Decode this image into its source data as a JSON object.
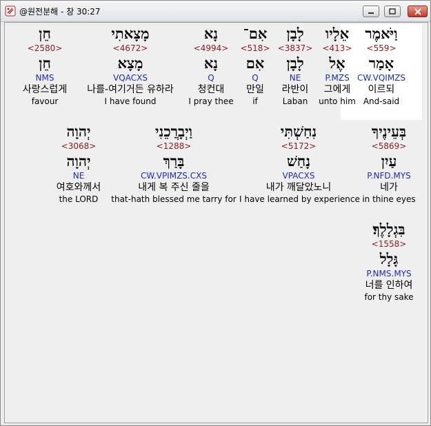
{
  "window": {
    "title": "@원전분해 - 창 30:27",
    "icon": "bible-icon"
  },
  "words": [
    {
      "heb": "וַיֹּאמֶר",
      "strong": "<559>",
      "lemma": "אָמַר",
      "parse": "CW.VQIMZS",
      "kor": "이르되",
      "eng": "And-said",
      "highlight": true
    },
    {
      "heb": "אֵלָיו",
      "strong": "<413>",
      "lemma": "אֶל",
      "parse": "P.MZS",
      "kor": "그에게",
      "eng": "unto him"
    },
    {
      "heb": "לָבָן",
      "strong": "<3837>",
      "lemma": "לָבָן",
      "parse": "NE",
      "kor": "라반이",
      "eng": "Laban"
    },
    {
      "heb": "אִם־",
      "strong": "<518>",
      "lemma": "אִם",
      "parse": "Q",
      "kor": "만일",
      "eng": "if"
    },
    {
      "heb": "נָא",
      "strong": "<4994>",
      "lemma": "נָא",
      "parse": "Q",
      "kor": "청컨대",
      "eng": "I pray thee"
    },
    {
      "heb": "מָצָאתִי",
      "strong": "<4672>",
      "lemma": "מָצָא",
      "parse": "VQACXS",
      "kor": "나를-여기거든 유하라",
      "eng": "I have found"
    },
    {
      "heb": "חֵן",
      "strong": "<2580>",
      "lemma": "חֵן",
      "parse": "NMS",
      "kor": "사랑스럽게",
      "eng": "favour"
    },
    {
      "heb": "בְּעֵינֶיךָ",
      "strong": "<5869>",
      "lemma": "עַיִן",
      "parse": "P.NFD.MYS",
      "kor": "네가",
      "eng": "in thine eyes"
    },
    {
      "heb": "נִחַשְׁתִּי",
      "strong": "<5172>",
      "lemma": "נָחַשׁ",
      "parse": "VPACXS",
      "kor": "내가 깨달았노니",
      "eng": "I have learned by experience"
    },
    {
      "heb": "וַיְבָרֲכֵנִי",
      "strong": "<1288>",
      "lemma": "בָּרַךְ",
      "parse": "CW.VPIMZS.CXS",
      "kor": "내게 복 주신 줄을",
      "eng": "that-hath blessed me tarry for"
    },
    {
      "heb": "יְהוָה",
      "strong": "<3068>",
      "lemma": "יְהוָה",
      "parse": "NE",
      "kor": "여호와께서",
      "eng": "the LORD"
    },
    {
      "heb": "בִּגְלָלֶךָ׃",
      "strong": "<1558>",
      "lemma": "גָּלָל",
      "parse": "P.NMS.MYS",
      "kor": "너를 인하여",
      "eng": "for thy sake"
    }
  ]
}
